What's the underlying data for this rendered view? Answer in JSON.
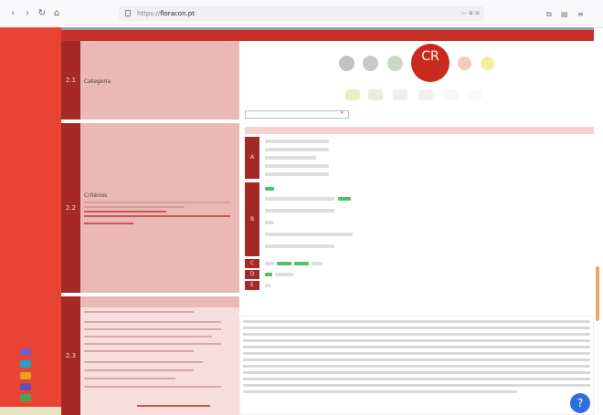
{
  "browser": {
    "url_prefix": "https://",
    "url_domain": "floracon.pt",
    "url_suffix": "",
    "zoom": "",
    "nav_icons": [
      "back-icon",
      "forward-icon",
      "reload-icon",
      "home-icon"
    ]
  },
  "colors": {
    "accent": "#c7312a",
    "side_panel": "#e84334",
    "label_bg": "#eab9b7",
    "threat_cr": "#c92a1d",
    "chip_green": "#4fc266",
    "help_button": "#2f6fd9"
  },
  "page": {
    "title": ""
  },
  "sections": [
    {
      "num": "2.1",
      "label": "Categoria"
    },
    {
      "num": "2.2",
      "label": "Critérios"
    },
    {
      "num": "2.3",
      "label": ""
    }
  ],
  "threat": {
    "active_label": "CR",
    "selected_option": ""
  },
  "criteria": {
    "header_label": "",
    "groups": [
      "A",
      "B",
      "C",
      "D",
      "E"
    ]
  },
  "help": {
    "label": "?"
  }
}
